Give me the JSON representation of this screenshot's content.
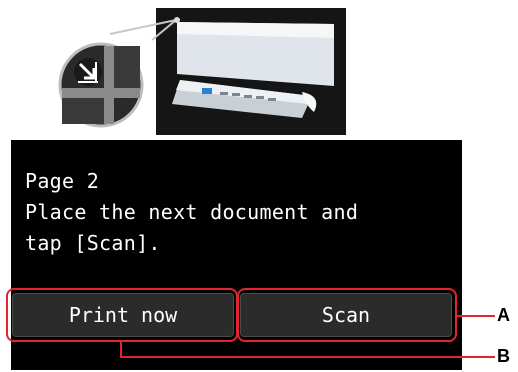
{
  "screen": {
    "message_lines": [
      "Page 2",
      "Place the next document and",
      "tap [Scan]."
    ]
  },
  "buttons": {
    "print_now": "Print now",
    "scan": "Scan"
  },
  "callouts": {
    "a": "A",
    "b": "B"
  },
  "colors": {
    "callout": "#e0262c",
    "screen_bg": "#000000",
    "button_bg": "#2b2b2b"
  },
  "icons": {
    "illustration": "document-feeder-illustration",
    "magnifier": "place-document-corner-icon"
  }
}
